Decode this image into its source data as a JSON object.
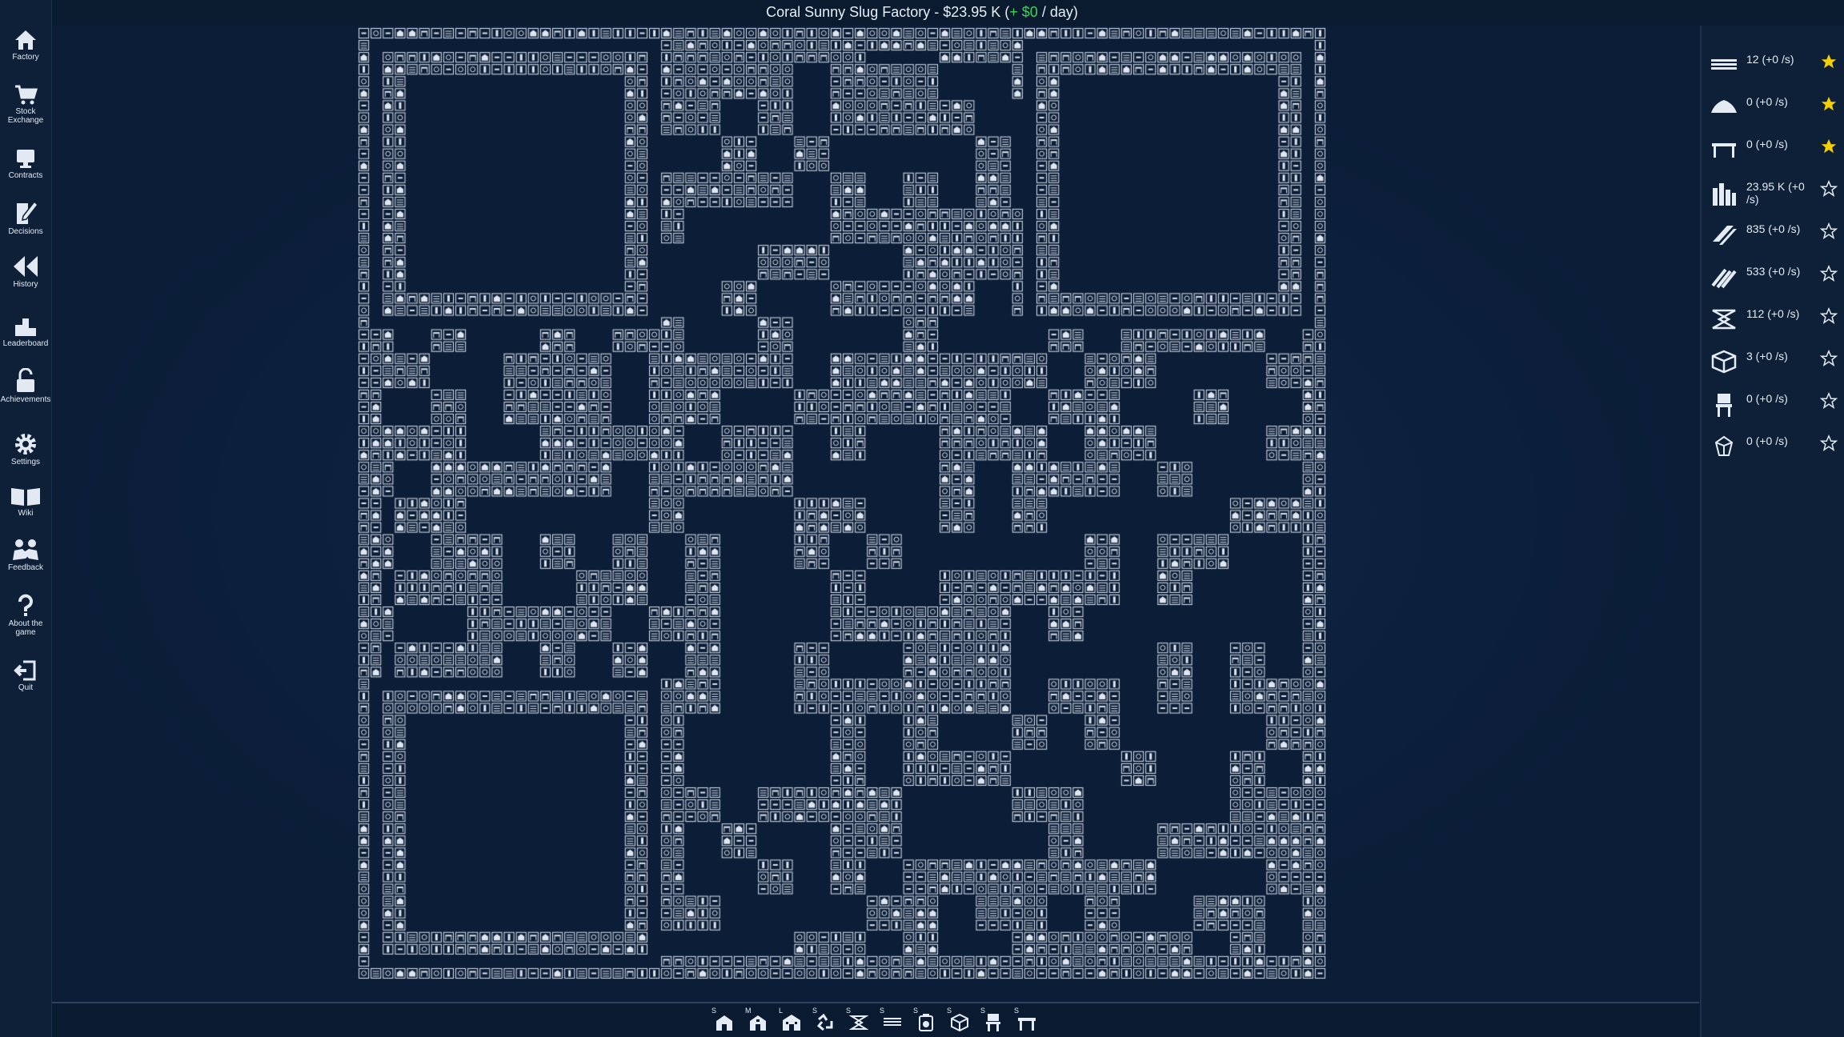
{
  "window_title": {
    "prefix": "Coral Sunny Slug Factory - $23.95 K (",
    "income": "+ $0",
    "suffix": " / day)"
  },
  "sidebar": {
    "items": [
      {
        "label": "Factory",
        "icon": "home-icon"
      },
      {
        "label": "Stock Exchange",
        "icon": "cart-icon"
      },
      {
        "label": "Contracts",
        "icon": "trophy-icon"
      },
      {
        "label": "Decisions",
        "icon": "edit-icon"
      },
      {
        "label": "History",
        "icon": "rewind-icon"
      },
      {
        "label": "Leaderboard",
        "icon": "podium-icon"
      },
      {
        "label": "Achievements",
        "icon": "unlock-icon"
      },
      {
        "label": "Settings",
        "icon": "gear-icon"
      },
      {
        "label": "Wiki",
        "icon": "book-icon"
      },
      {
        "label": "Feedback",
        "icon": "handshake-icon"
      },
      {
        "label": "About the game",
        "icon": "question-icon"
      },
      {
        "label": "Quit",
        "icon": "exit-icon"
      }
    ]
  },
  "resources": [
    {
      "text": "12 (+0 /s)",
      "icon": "conveyor-icon",
      "starred": true
    },
    {
      "text": "0 (+0 /s)",
      "icon": "pile-icon",
      "starred": true
    },
    {
      "text": "0 (+0 /s)",
      "icon": "table-icon",
      "starred": true
    },
    {
      "text": "23.95 K (+0 /s)",
      "icon": "money-stack-icon",
      "starred": false
    },
    {
      "text": "835 (+0 /s)",
      "icon": "planks-icon",
      "starred": false
    },
    {
      "text": "533 (+0 /s)",
      "icon": "logs-icon",
      "starred": false
    },
    {
      "text": "112 (+0 /s)",
      "icon": "fabric-icon",
      "starred": false
    },
    {
      "text": "3 (+0 /s)",
      "icon": "box-icon",
      "starred": false
    },
    {
      "text": "0 (+0 /s)",
      "icon": "chair-icon",
      "starred": false
    },
    {
      "text": "0 (+0 /s)",
      "icon": "gem-icon",
      "starred": false
    }
  ],
  "toolbar": [
    {
      "key": "S",
      "icon": "small-building-icon"
    },
    {
      "key": "M",
      "icon": "medium-building-icon"
    },
    {
      "key": "L",
      "icon": "large-building-icon"
    },
    {
      "key": "S",
      "icon": "recycle-icon"
    },
    {
      "key": "S",
      "icon": "fabric-machine-icon"
    },
    {
      "key": "S",
      "icon": "conveyor-machine-icon"
    },
    {
      "key": "S",
      "icon": "saw-machine-icon"
    },
    {
      "key": "S",
      "icon": "box-machine-icon"
    },
    {
      "key": "S",
      "icon": "chair-machine-icon"
    },
    {
      "key": "S",
      "icon": "table-machine-icon"
    }
  ],
  "colors": {
    "background": "#0b1c33",
    "panel": "#0d2038",
    "income_green": "#3ed35a",
    "star_yellow": "#f5d000",
    "tile": "#dfe6ef"
  },
  "factory_grid": {
    "rows": 79,
    "cols": 80,
    "pattern": "qr-code-of-machine-tiles"
  }
}
